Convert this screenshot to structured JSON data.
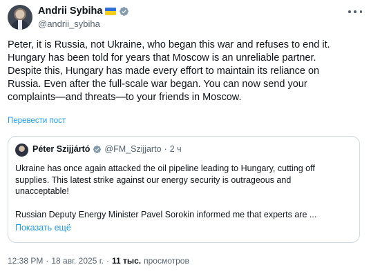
{
  "author": {
    "display_name": "Andrii Sybiha",
    "handle": "@andrii_sybiha"
  },
  "tweet": {
    "lines": [
      "Peter, it is Russia, not Ukraine, who began this war and refuses to end it.",
      "Hungary has been told for years that Moscow is an unreliable partner.",
      "Despite this, Hungary has made every effort to maintain its reliance on",
      "Russia. Even after the full-scale war began. You can now send your",
      "complaints—and threats—to your friends in Moscow."
    ],
    "translate_label": "Перевести пост"
  },
  "quote": {
    "display_name": "Péter Szijjártó",
    "handle": "@FM_Szijjarto",
    "separator": "·",
    "time": "2 ч",
    "paragraph1_lines": [
      "Ukraine has once again attacked the oil pipeline leading to Hungary, cutting off",
      "supplies. This latest strike against our energy security is outrageous and",
      "unacceptable!"
    ],
    "paragraph2": "Russian Deputy Energy Minister Pavel Sorokin informed me that experts are ...",
    "show_more": "Показать ещё"
  },
  "meta": {
    "time": "12:38 PM",
    "dot1": "·",
    "date": "18 авг. 2025 г.",
    "dot2": "·",
    "views_count": "11 тыс.",
    "views_label": "просмотров"
  },
  "colors": {
    "link": "#1d9bf0",
    "verified": "#829aab",
    "secondary_text": "#536471"
  },
  "icons": [
    "ukraine-flag-icon",
    "verified-badge-icon",
    "more-options-icon"
  ]
}
